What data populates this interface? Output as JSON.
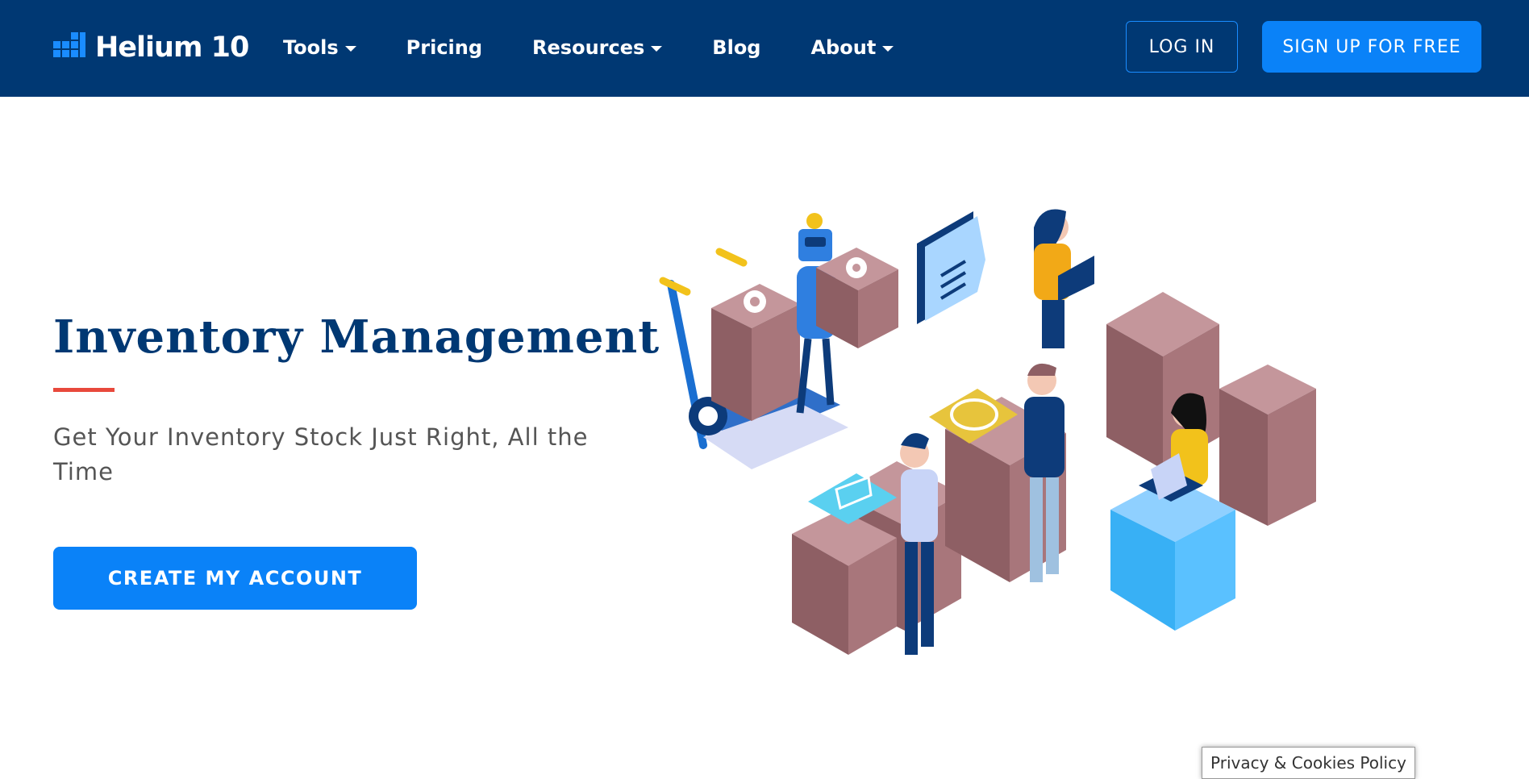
{
  "brand": {
    "name": "Helium 10",
    "icon": "bar-chart-icon"
  },
  "nav": {
    "items": [
      {
        "label": "Tools",
        "has_dropdown": true
      },
      {
        "label": "Pricing",
        "has_dropdown": false
      },
      {
        "label": "Resources",
        "has_dropdown": true
      },
      {
        "label": "Blog",
        "has_dropdown": false
      },
      {
        "label": "About",
        "has_dropdown": true
      }
    ]
  },
  "header": {
    "login_label": "LOG IN",
    "signup_label": "SIGN UP FOR FREE"
  },
  "hero": {
    "title": "Inventory Management",
    "subtitle": "Get Your Inventory Stock Just Right, All the Time",
    "cta_label": "CREATE MY ACCOUNT"
  },
  "cookie": {
    "label": "Privacy & Cookies Policy"
  },
  "colors": {
    "header_bg": "#003873",
    "accent_blue": "#0a82f8",
    "title_color": "#003873",
    "accent_red": "#e8493c",
    "box_color": "#a8767b"
  }
}
